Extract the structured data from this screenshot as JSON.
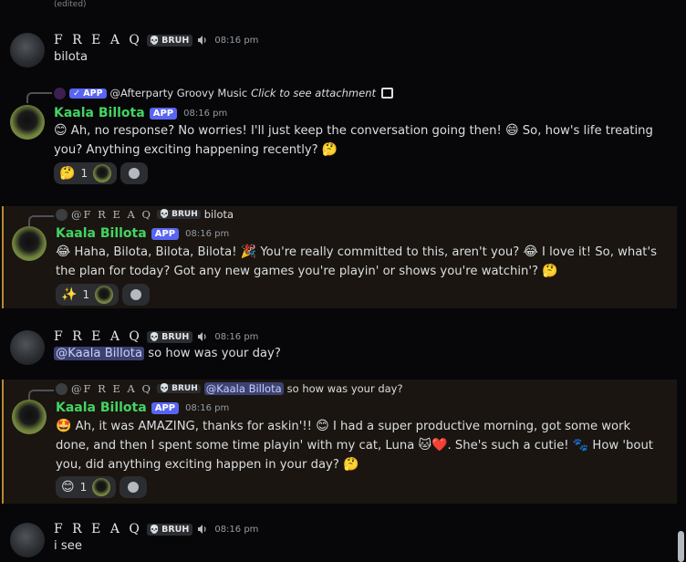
{
  "edited_label": "(edited)",
  "messages": [
    {
      "user": "F R E A Q",
      "tag": "BRUH",
      "time": "08:16 pm",
      "text": "bilota"
    },
    {
      "reply": {
        "app_badge": "✓ APP",
        "name": "@Afterparty Groovy Music",
        "text": "Click to see attachment"
      },
      "user": "Kaala Billota",
      "badge": "APP",
      "time": "08:16 pm",
      "text_parts": [
        "😊",
        " Ah, no response? No worries! I'll just keep the conversation going then! ",
        "😄",
        " So, how's life treating you? Anything exciting happening recently? ",
        "🤔"
      ],
      "reaction": {
        "emoji": "🤔",
        "count": "1"
      }
    },
    {
      "reply": {
        "name": "@F R E A Q",
        "tag": "BRUH",
        "text": "bilota"
      },
      "user": "Kaala Billota",
      "badge": "APP",
      "time": "08:16 pm",
      "text_parts": [
        "😂",
        " Haha, Bilota, Bilota, Bilota! ",
        "🎉",
        " You're really committed to this, aren't you? ",
        "😂",
        " I love it! So, what's the plan for today? Got any new games you're playin' or shows you're watchin'? ",
        "🤔"
      ],
      "reaction": {
        "emoji": "✨",
        "count": "1"
      }
    },
    {
      "user": "F R E A Q",
      "tag": "BRUH",
      "time": "08:16 pm",
      "mention": "@Kaala Billota",
      "text": " so how was your day?"
    },
    {
      "reply": {
        "name": "@F R E A Q",
        "tag": "BRUH",
        "mention": "@Kaala Billota",
        "text": "so how was your day?"
      },
      "user": "Kaala Billota",
      "badge": "APP",
      "time": "08:16 pm",
      "text_parts": [
        "🤩",
        " Ah, it was AMAZING, thanks for askin'!! ",
        "😊",
        " I had a super productive morning, got some work done, and then I spent some time playin' with my cat, Luna ",
        "🐱❤️",
        ". She's such a cutie! ",
        "🐾",
        " How 'bout you, did anything exciting happen in your day? ",
        "🤔"
      ],
      "reaction": {
        "emoji": "😊",
        "count": "1"
      }
    },
    {
      "user": "F R E A Q",
      "tag": "BRUH",
      "time": "08:16 pm",
      "text": "i see"
    }
  ]
}
